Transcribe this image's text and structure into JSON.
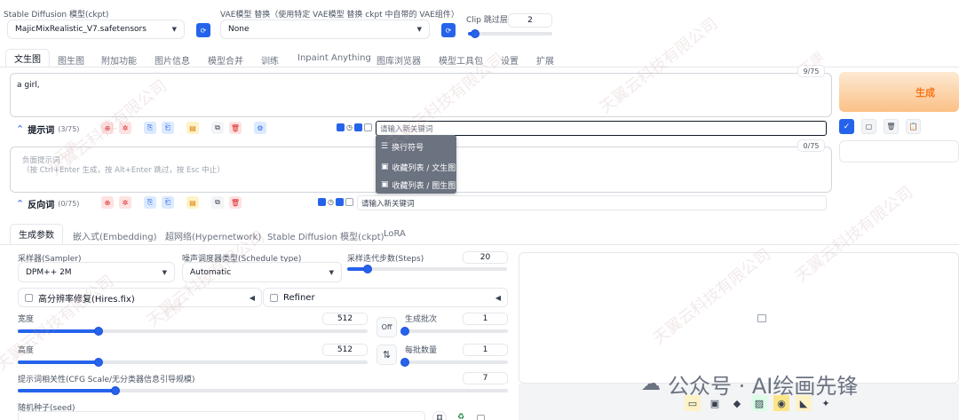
{
  "top": {
    "model_label": "Stable Diffusion 模型(ckpt)",
    "model_value": "MajicMixRealistic_V7.safetensors",
    "vae_label": "VAE模型 替换（使用特定 VAE模型 替换 ckpt 中自带的 VAE组件）",
    "vae_value": "None",
    "clip_label": "Clip 跳过层",
    "clip_value": "2",
    "clip_level": 0.08
  },
  "tabs": [
    "文生图",
    "图生图",
    "附加功能",
    "图片信息",
    "模型合并",
    "训练",
    "Inpaint Anything",
    "图库浏览器",
    "模型工具包",
    "设置",
    "扩展"
  ],
  "prompt": {
    "text": "a girl,",
    "counter": "9/75",
    "section_label": "提示词",
    "section_count": "(3/75)",
    "keyword_placeholder": "请输入新关键词"
  },
  "generate": {
    "label": "生成"
  },
  "menu": {
    "items": [
      "换行符号",
      "收藏列表 / 文生图",
      "收藏列表 / 图生图"
    ]
  },
  "negative": {
    "placeholder_line1": "负面提示词",
    "placeholder_line2": "（按 Ctrl+Enter 生成，按 Alt+Enter 跳过，按 Esc 中止）",
    "counter": "0/75",
    "section_label": "反向词",
    "section_count": "(0/75)",
    "keyword_placeholder": "请输入新关键词"
  },
  "subtabs": [
    "生成参数",
    "嵌入式(Embedding)",
    "超网络(Hypernetwork)",
    "Stable Diffusion 模型(ckpt)",
    "LoRA"
  ],
  "params": {
    "sampler_label": "采样器(Sampler)",
    "sampler_value": "DPM++ 2M",
    "schedule_label": "噪声调度器类型(Schedule type)",
    "schedule_value": "Automatic",
    "steps_label": "采样迭代步数(Steps)",
    "steps_value": "20",
    "steps_level": 0.13,
    "hires_label": "高分辨率修复(Hires.fix)",
    "refiner_label": "Refiner",
    "width_label": "宽度",
    "width_value": "512",
    "width_level": 0.23,
    "height_label": "高度",
    "height_value": "512",
    "height_level": 0.23,
    "off_label": "Off",
    "swap_icon": "⇅",
    "batch_count_label": "生成批次",
    "batch_count_value": "1",
    "batch_count_level": 0.0,
    "batch_size_label": "每批数量",
    "batch_size_value": "1",
    "batch_size_level": 0.0,
    "cfg_label": "提示词相关性(CFG Scale/无分类器信息引导规模)",
    "cfg_value": "7",
    "cfg_level": 0.2,
    "seed_label": "随机种子(seed)"
  },
  "watermark": {
    "brand": "公众号 · AI绘画先锋",
    "tiles": [
      "天翼云科技有限公司",
      "天翼云科技有限公司",
      "工康",
      "天翼云科技有限公司",
      "工康",
      "天翼云科技有限公司",
      "天翼云科技有限公司",
      "工康",
      "天翼云科技有限公司",
      "天翼云科技有限公司"
    ]
  },
  "colors": {
    "accent": "#2563eb",
    "generate_from": "#fde7cf",
    "generate_to": "#f59e3b",
    "generate_text": "#f97316",
    "menu_bg": "#6b7280"
  }
}
